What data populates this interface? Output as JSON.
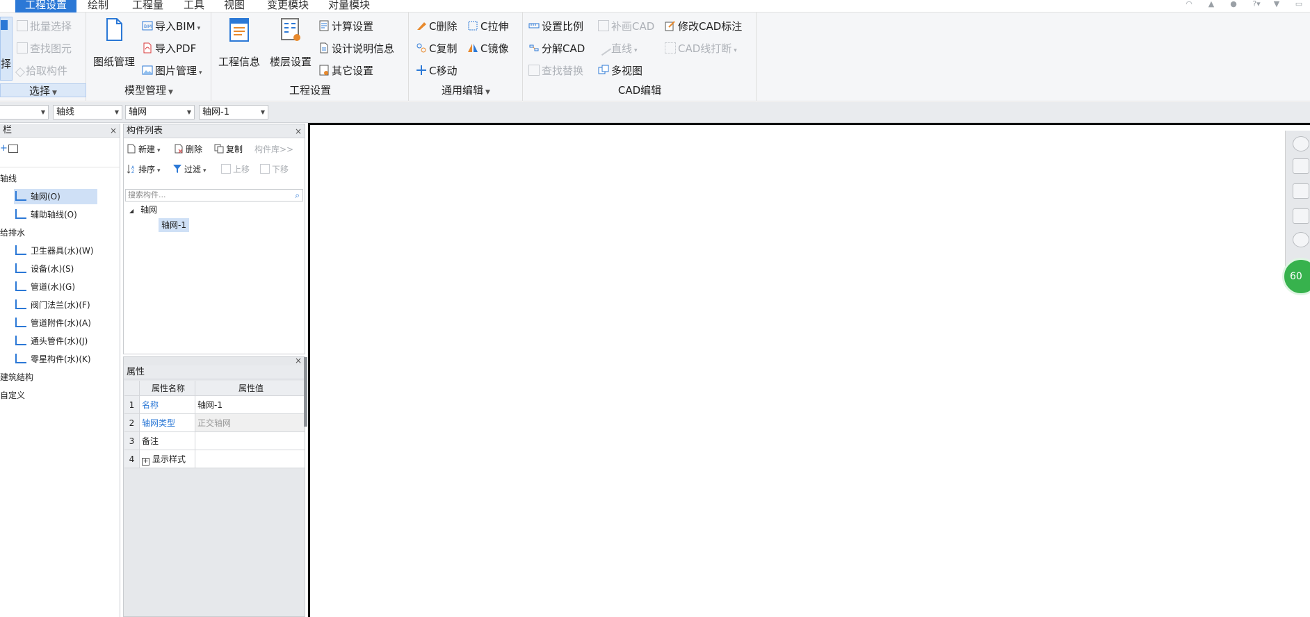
{
  "menu": {
    "tabs": [
      "工程设置",
      "绘制",
      "工程量",
      "工具",
      "视图",
      "变更模块",
      "对量模块"
    ],
    "active": "工程设置"
  },
  "ribbon": {
    "select_group": {
      "partial_big": "择",
      "batch_select": "批量选择",
      "find_element": "查找图元",
      "pick_component": "拾取构件",
      "label": "选择"
    },
    "model_group": {
      "drawing_manage": "图纸管理",
      "import_bim": "导入BIM",
      "import_pdf": "导入PDF",
      "image_manage": "图片管理",
      "label": "模型管理"
    },
    "project_group": {
      "project_info": "工程信息",
      "floor_settings": "楼层设置",
      "calc_settings": "计算设置",
      "design_notes": "设计说明信息",
      "other_settings": "其它设置",
      "label": "工程设置"
    },
    "edit_group": {
      "delete": "C删除",
      "stretch": "C拉伸",
      "copy": "C复制",
      "mirror": "C镜像",
      "move": "C移动",
      "label": "通用编辑"
    },
    "cad_group": {
      "set_scale": "设置比例",
      "draw_cad": "补画CAD",
      "modify_cad_label": "修改CAD标注",
      "explode_cad": "分解CAD",
      "line": "直线",
      "cad_break": "CAD线打断",
      "find_replace": "查找替换",
      "multi_view": "多视图",
      "label": "CAD编辑"
    }
  },
  "combos": [
    "",
    "轴线",
    "轴网",
    "轴网-1"
  ],
  "leftnav": {
    "title": "栏",
    "items": [
      {
        "label": "轴线",
        "level": 0
      },
      {
        "label": "轴网(O)",
        "level": 1,
        "selected": true
      },
      {
        "label": "辅助轴线(O)",
        "level": 1
      },
      {
        "label": "给排水",
        "level": 0
      },
      {
        "label": "卫生器具(水)(W)",
        "level": 1
      },
      {
        "label": "设备(水)(S)",
        "level": 1
      },
      {
        "label": "管道(水)(G)",
        "level": 1
      },
      {
        "label": "阀门法兰(水)(F)",
        "level": 1
      },
      {
        "label": "管道附件(水)(A)",
        "level": 1
      },
      {
        "label": "通头管件(水)(J)",
        "level": 1
      },
      {
        "label": "零星构件(水)(K)",
        "level": 1
      },
      {
        "label": "建筑结构",
        "level": 0
      },
      {
        "label": "自定义",
        "level": 0
      }
    ]
  },
  "complist": {
    "title": "构件列表",
    "new": "新建",
    "delete": "删除",
    "copy": "复制",
    "library": "构件库>>",
    "sort": "排序",
    "filter": "过滤",
    "move_up": "上移",
    "move_down": "下移",
    "search_placeholder": "搜索构件...",
    "tree_root": "轴网",
    "tree_child": "轴网-1"
  },
  "properties": {
    "title": "属性",
    "col_name": "属性名称",
    "col_value": "属性值",
    "rows": [
      {
        "idx": "1",
        "name": "名称",
        "value": "轴网-1"
      },
      {
        "idx": "2",
        "name": "轴网类型",
        "value": "正交轴网"
      },
      {
        "idx": "3",
        "name": "备注",
        "value": ""
      },
      {
        "idx": "4",
        "name": "显示样式",
        "value": ""
      }
    ]
  },
  "badge": "60",
  "colors": {
    "accent": "#2b78d6",
    "green": "#37b24d"
  }
}
